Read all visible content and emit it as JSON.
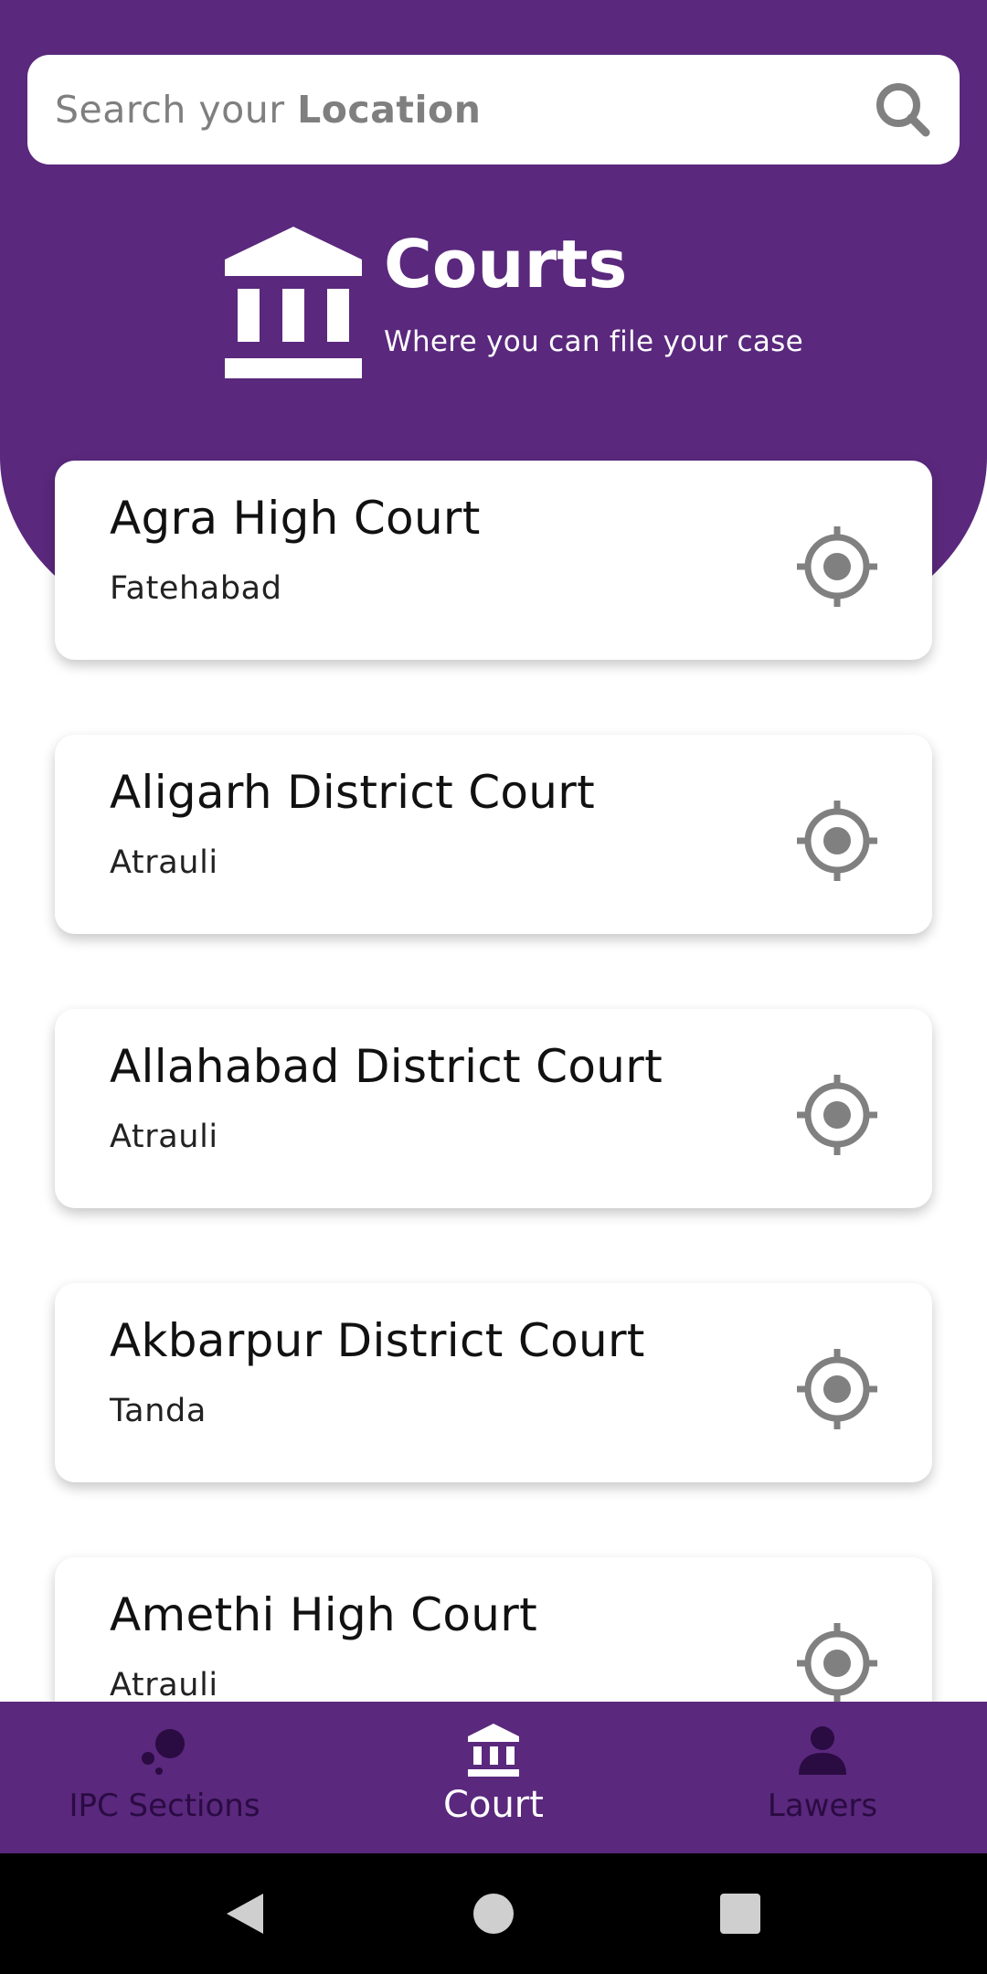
{
  "search": {
    "placeholder_prefix": "Search your ",
    "placeholder_bold": "Location"
  },
  "header": {
    "title": "Courts",
    "subtitle": "Where you can file your case"
  },
  "courts": [
    {
      "name": "Agra High Court",
      "location": "Fatehabad"
    },
    {
      "name": "Aligarh District Court",
      "location": "Atrauli"
    },
    {
      "name": "Allahabad District Court",
      "location": "Atrauli"
    },
    {
      "name": "Akbarpur District Court",
      "location": "Tanda"
    },
    {
      "name": "Amethi High Court",
      "location": "Atrauli"
    }
  ],
  "bottom_nav": {
    "items": [
      {
        "label": "IPC Sections",
        "icon": "bubbles-icon",
        "active": false
      },
      {
        "label": "Court",
        "icon": "court-icon",
        "active": true
      },
      {
        "label": "Lawers",
        "icon": "person-icon",
        "active": false
      }
    ]
  },
  "colors": {
    "primary": "#5a287d",
    "icon_gray": "#808080",
    "nav_inactive": "#2a0b42"
  }
}
